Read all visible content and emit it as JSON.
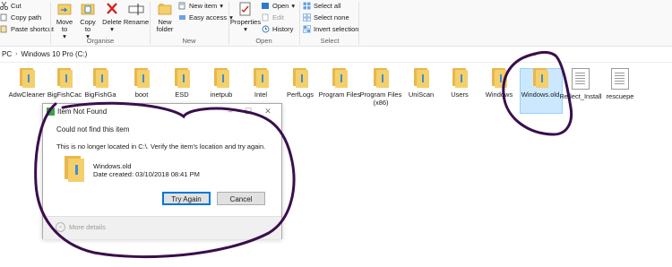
{
  "ribbon": {
    "clipboard": {
      "cut": "Cut",
      "copy_path": "Copy path",
      "paste_shortcut": "Paste shortcut"
    },
    "organise": {
      "label": "Organise",
      "move_to": "Move to",
      "copy_to": "Copy to",
      "delete": "Delete",
      "rename": "Rename"
    },
    "new": {
      "label": "New",
      "new_folder": "New folder",
      "new_item": "New item",
      "easy_access": "Easy access"
    },
    "open": {
      "label": "Open",
      "properties": "Properties",
      "open": "Open",
      "edit": "Edit",
      "history": "History"
    },
    "select": {
      "label": "Select",
      "select_all": "Select all",
      "select_none": "Select none",
      "invert_selection": "Invert selection"
    }
  },
  "address": {
    "crumb_pc": "PC",
    "crumb_drive": "Windows 10 Pro (C:)"
  },
  "items": [
    {
      "label": "AdwCleaner",
      "type": "folder"
    },
    {
      "label": "BigFishCac",
      "type": "folder"
    },
    {
      "label": "BigFishGa",
      "type": "folder"
    },
    {
      "label": "boot",
      "type": "folder"
    },
    {
      "label": "ESD",
      "type": "folder"
    },
    {
      "label": "inetpub",
      "type": "folder"
    },
    {
      "label": "Intel",
      "type": "folder"
    },
    {
      "label": "PerfLogs",
      "type": "folder"
    },
    {
      "label": "Program Files",
      "type": "folder"
    },
    {
      "label": "Program Files (x86)",
      "type": "folder"
    },
    {
      "label": "UniScan",
      "type": "folder"
    },
    {
      "label": "Users",
      "type": "folder"
    },
    {
      "label": "Windows",
      "type": "folder"
    },
    {
      "label": "Windows.old",
      "type": "folder",
      "selected": true
    },
    {
      "label": "Reflect_Install",
      "type": "file"
    },
    {
      "label": "rescuepe",
      "type": "file"
    }
  ],
  "dialog": {
    "title": "Item Not Found",
    "heading": "Could not find this item",
    "message": "This is no longer located in C:\\. Verify the item's location and try again.",
    "file_name": "Windows.old",
    "file_date": "Date created: 03/10/2018 08:41 PM",
    "try_again": "Try Again",
    "cancel": "Cancel",
    "more_details": "More details"
  },
  "colors": {
    "annotation": "#3a0e4c",
    "selection": "#cce8ff",
    "folder": "#f4cf6a",
    "accent": "#0078d7"
  }
}
